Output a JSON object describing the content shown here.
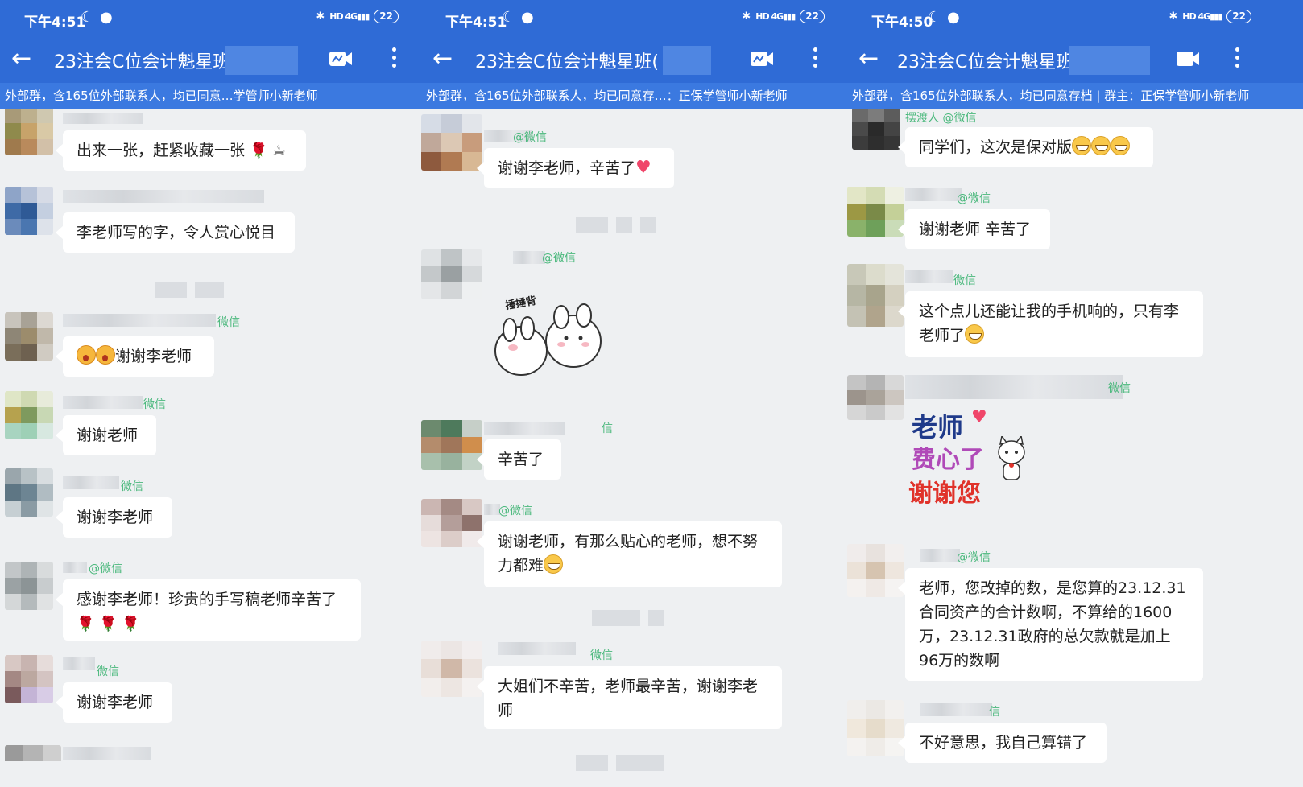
{
  "panels": [
    {
      "status": {
        "time": "下午4:51",
        "icons": "☾ ●",
        "battery": "22"
      },
      "header": {
        "title": "23注会C位会计魁星班",
        "subtitle": "外部群，含165位外部联系人，均已同意…学管师小新老师"
      },
      "messages": [
        {
          "text": "出来一张，赶紧收藏一张"
        },
        {
          "text": "李老师写的字，令人赏心悦目"
        },
        {
          "sender": "微信",
          "text": "谢谢李老师"
        },
        {
          "sender": "微信",
          "text": "谢谢老师"
        },
        {
          "sender": "微信",
          "text": "谢谢李老师"
        },
        {
          "sender": "@微信",
          "text": "感谢李老师！珍贵的手写稿老师辛苦了"
        },
        {
          "sender": "微信",
          "text": "谢谢李老师"
        }
      ]
    },
    {
      "status": {
        "time": "下午4:51",
        "icons": "☾ ●",
        "battery": "22"
      },
      "header": {
        "title": "23注会C位会计魁星班(",
        "subtitle": "外部群，含165位外部联系人，均已同意存…：正保学管师小新老师"
      },
      "messages": [
        {
          "sender": "@微信",
          "text": "谢谢李老师，辛苦了"
        },
        {
          "sender": "@微信",
          "sticker_caption": "捶捶背"
        },
        {
          "sender": "信",
          "text": "辛苦了"
        },
        {
          "sender": "@微信",
          "text": "谢谢老师，有那么贴心的老师，想不努力都难"
        },
        {
          "sender": "微信",
          "text": "大姐们不辛苦，老师最辛苦，谢谢李老师"
        }
      ]
    },
    {
      "status": {
        "time": "下午4:50",
        "icons": "☾ ●",
        "battery": "22"
      },
      "header": {
        "title": "23注会C位会计魁星班",
        "subtitle": "外部群，含165位外部联系人，均已同意存档 | 群主：正保学管师小新老师"
      },
      "messages": [
        {
          "sender": "摆渡人 @微信",
          "text": "同学们，这次是保对版"
        },
        {
          "sender": "@微信",
          "text": "谢谢老师 辛苦了"
        },
        {
          "sender": "微信",
          "text": "这个点儿还能让我的手机响的，只有李老师了"
        },
        {
          "sender": "微信",
          "sticker_lines": [
            "老师",
            "费心了",
            "谢谢您"
          ]
        },
        {
          "sender": "@微信",
          "text": "老师，您改掉的数，是您算的23.12.31合同资产的合计数啊，不算给的1600万，23.12.31政府的总欠款就是加上96万的数啊"
        },
        {
          "sender": "信",
          "text": "不好意思，我自己算错了"
        }
      ]
    }
  ]
}
